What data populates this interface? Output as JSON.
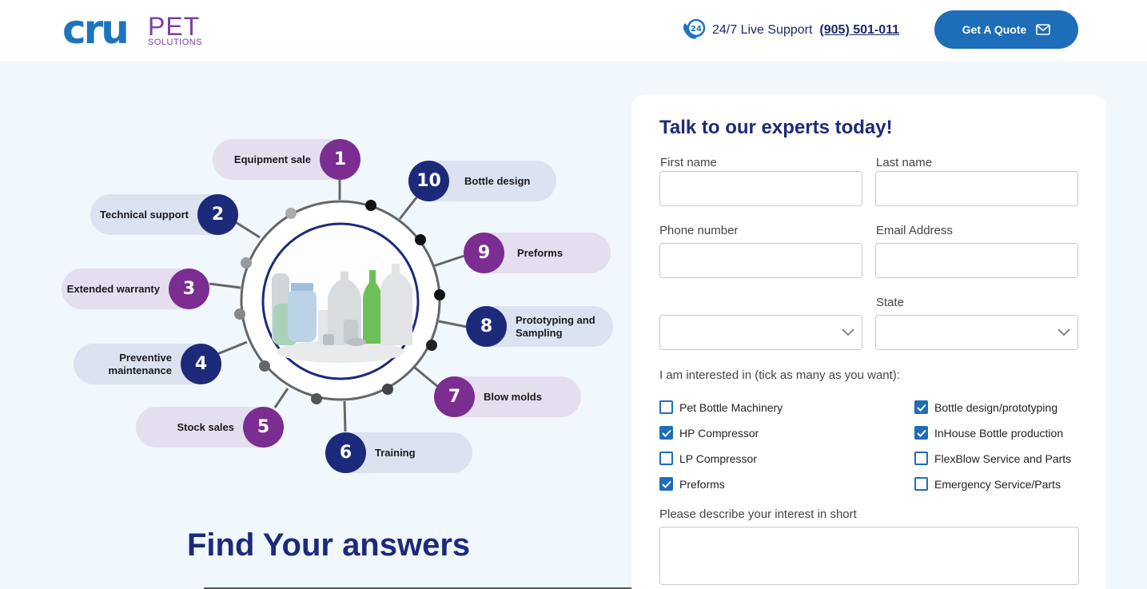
{
  "header": {
    "logo_main": "cru",
    "logo_pet": "PET",
    "logo_sub": "SOLUTIONS",
    "support_icon_text": "24",
    "support_label": "24/7 Live Support",
    "support_phone": "(905) 501-011",
    "quote_label": "Get A Quote",
    "colors": {
      "brand_blue": "#1e73be",
      "brand_purple": "#7b3fa0",
      "navy": "#1d2a7a"
    }
  },
  "services": [
    {
      "num": "1",
      "label": "Equipment sale"
    },
    {
      "num": "2",
      "label": "Technical support"
    },
    {
      "num": "3",
      "label": "Extended warranty"
    },
    {
      "num": "4",
      "label": "Preventive maintenance"
    },
    {
      "num": "5",
      "label": "Stock sales"
    },
    {
      "num": "6",
      "label": "Training"
    },
    {
      "num": "7",
      "label": "Blow molds"
    },
    {
      "num": "8",
      "label": "Prototyping and Sampling"
    },
    {
      "num": "9",
      "label": "Preforms"
    },
    {
      "num": "10",
      "label": "Bottle design"
    }
  ],
  "find_title": "Find Your answers",
  "form": {
    "title": "Talk to our experts today!",
    "first_name_label": "First name",
    "last_name_label": "Last name",
    "phone_label": "Phone number",
    "email_label": "Email Address",
    "state_label": "State",
    "interest_label": "I am interested in (tick as many as you want):",
    "checkboxes": [
      {
        "label": "Pet Bottle Machinery",
        "checked": false
      },
      {
        "label": "Bottle design/prototyping",
        "checked": true
      },
      {
        "label": "HP Compressor",
        "checked": true
      },
      {
        "label": "InHouse Bottle production",
        "checked": true
      },
      {
        "label": "LP Compressor",
        "checked": false
      },
      {
        "label": "FlexBlow Service and Parts",
        "checked": false
      },
      {
        "label": "Preforms",
        "checked": true
      },
      {
        "label": "Emergency Service/Parts",
        "checked": false
      }
    ],
    "describe_label": "Please describe your interest in short"
  }
}
